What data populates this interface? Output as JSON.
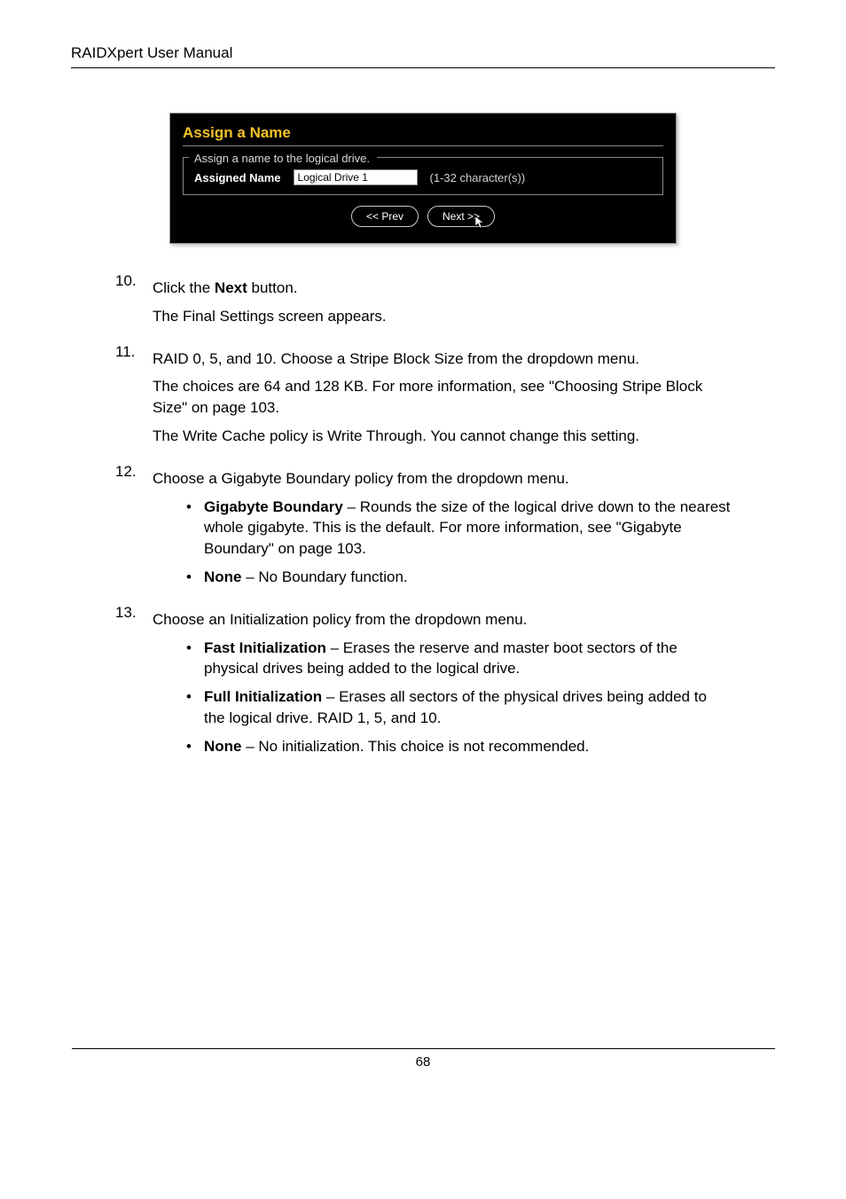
{
  "header": {
    "title": "RAIDXpert User Manual"
  },
  "screenshot": {
    "panel_title": "Assign a Name",
    "caption": "Assign a name to the logical drive.",
    "assigned_label": "Assigned Name",
    "input_value": "Logical Drive 1",
    "char_hint": "(1-32 character(s))",
    "prev_btn": "<< Prev",
    "next_btn": "Next >>"
  },
  "steps": {
    "s10_num": "10.",
    "s10_line1": "Click the ",
    "s10_bold": "Next",
    "s10_line1b": " button.",
    "s10_line2": "The Final Settings screen appears.",
    "s11_num": "11.",
    "s11_line1": "RAID 0, 5, and 10. Choose a Stripe Block Size from the dropdown menu.",
    "s11_line2": "The choices are 64 and 128 KB. For more information, see \"Choosing Stripe Block Size\" on page 103.",
    "s11_line3": "The Write Cache policy is Write Through. You cannot change this setting.",
    "s12_num": "12.",
    "s12_line1": "Choose a Gigabyte Boundary policy from the dropdown menu.",
    "s12_b1_bold": "Gigabyte Boundary",
    "s12_b1_text": " – Rounds the size of the logical drive down to the nearest whole gigabyte. This is the default. For more information, see \"Gigabyte Boundary\" on page 103.",
    "s12_b2_bold": "None",
    "s12_b2_text": " – No Boundary function.",
    "s13_num": "13.",
    "s13_line1": "Choose an Initialization policy from the dropdown menu.",
    "s13_b1_bold": "Fast Initialization",
    "s13_b1_text": " – Erases the reserve and master boot sectors of the physical drives being added to the logical drive.",
    "s13_b2_bold": "Full Initialization",
    "s13_b2_text": " – Erases all sectors of the physical drives being added to the logical drive. RAID 1, 5, and 10.",
    "s13_b3_bold": "None",
    "s13_b3_text": " – No initialization. This choice is not recommended."
  },
  "footer": {
    "page_number": "68"
  }
}
